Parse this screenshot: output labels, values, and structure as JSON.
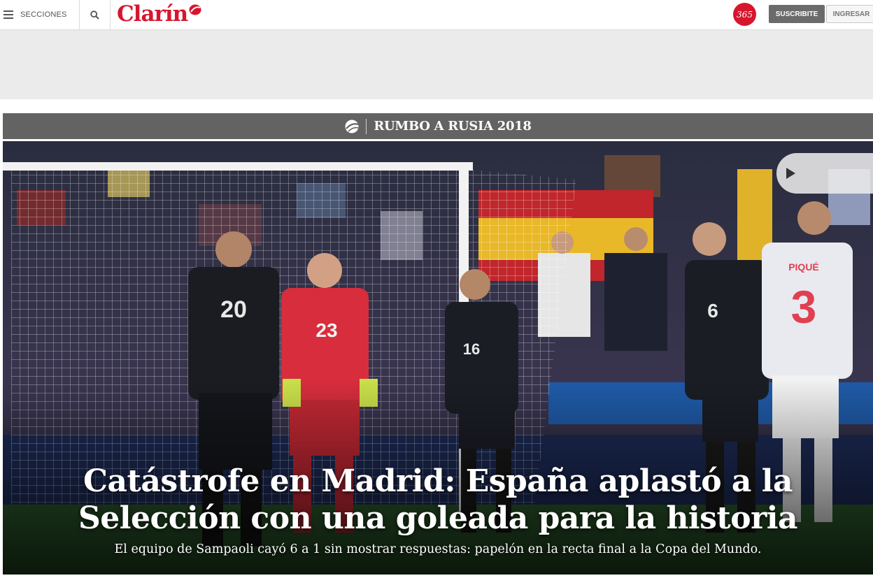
{
  "header": {
    "sections_label": "SECCIONES",
    "logo_text": "Clarín",
    "badge_365": "365",
    "subscribe_label": "SUSCRIBITE",
    "login_label": "INGRESAR"
  },
  "section_bar": {
    "title": "RUMBO A RUSIA 2018"
  },
  "hero": {
    "headline_line1": "Catástrofe en Madrid: España aplastó a la",
    "headline_line2": "Selección con una goleada para la historia",
    "subheadline": "El equipo de Sampaoli cayó 6 a 1 sin mostrar respuestas: papelón en la recta final a la Copa del Mundo.",
    "jersey_numbers": [
      "20",
      "23",
      "16",
      "6",
      "3"
    ],
    "jersey_name": "PIQUÉ"
  },
  "colors": {
    "brand_red": "#d7162e",
    "section_bar": "#636363",
    "ad_strip": "#ebebeb"
  }
}
